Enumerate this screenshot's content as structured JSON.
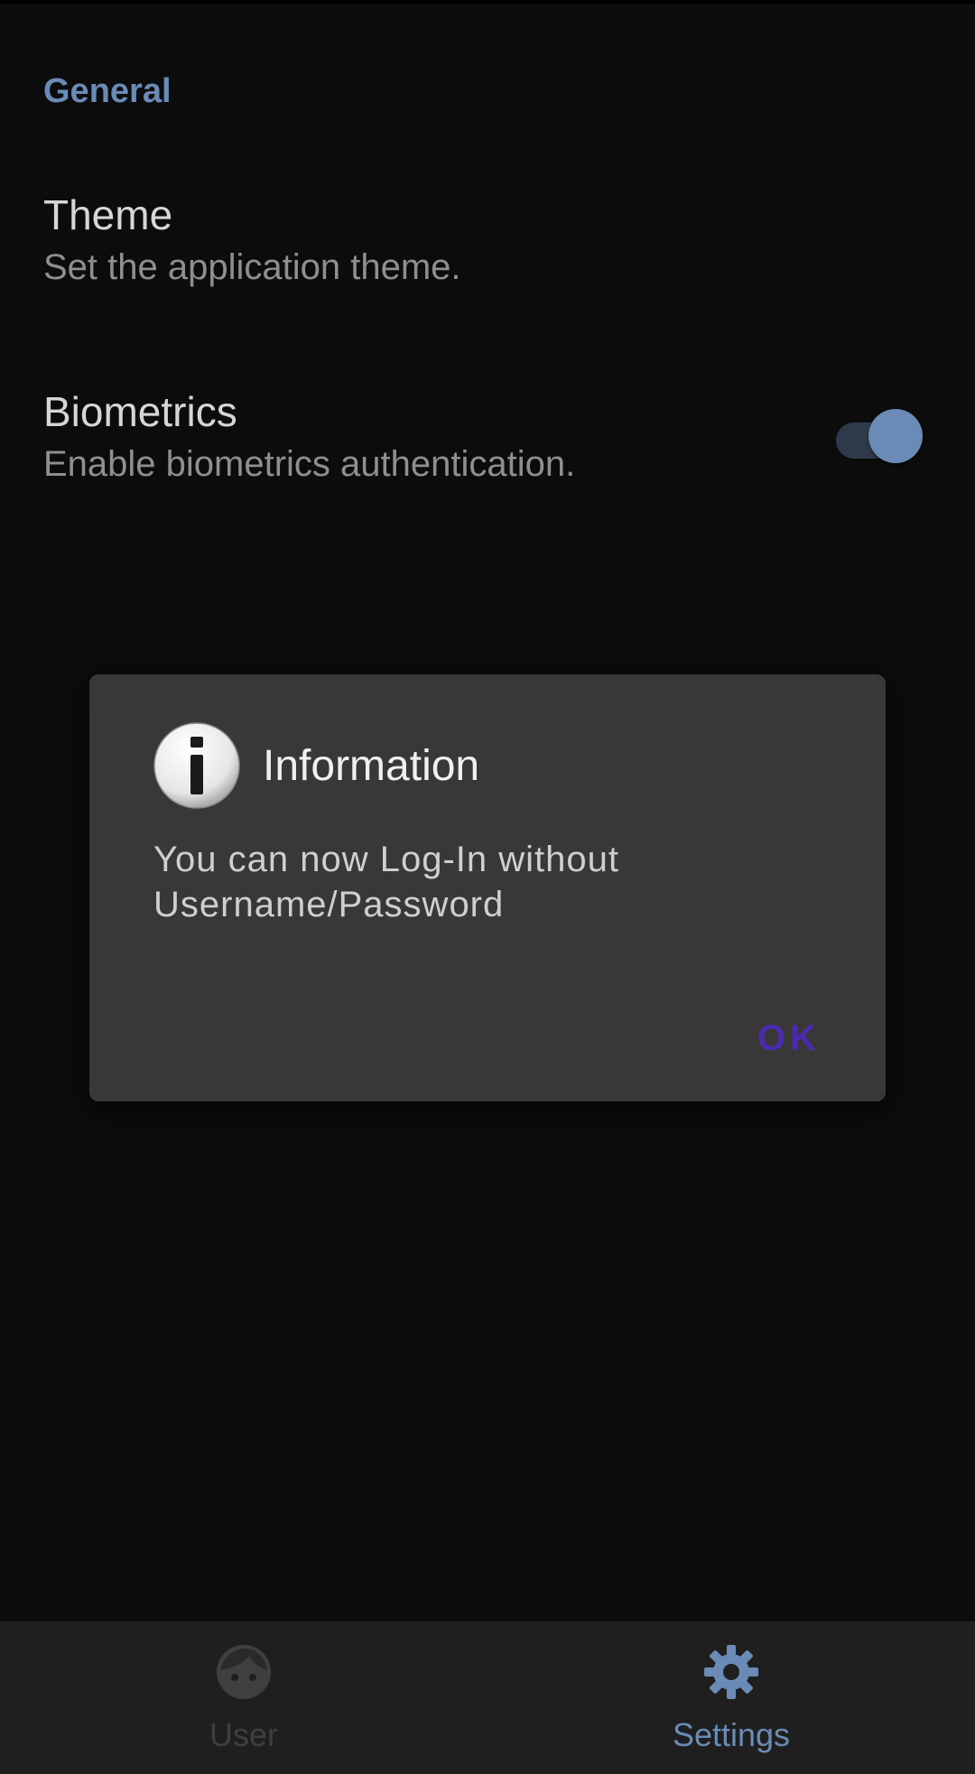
{
  "settings": {
    "section_header": "General",
    "theme": {
      "title": "Theme",
      "summary": "Set the application theme."
    },
    "biometrics": {
      "title": "Biometrics",
      "summary": "Enable biometrics authentication.",
      "enabled": true
    }
  },
  "dialog": {
    "icon": "info-icon",
    "title": "Information",
    "message": "You can now Log-In without Username/Password",
    "ok_label": "OK"
  },
  "bottom_nav": {
    "items": [
      {
        "label": "User",
        "icon": "face-icon",
        "active": false
      },
      {
        "label": "Settings",
        "icon": "gear-icon",
        "active": true
      }
    ]
  },
  "colors": {
    "accent": "#6a8bb6",
    "background": "#0c0c0c",
    "dialog_background": "#383838",
    "dialog_button": "#4a2bb0",
    "nav_background": "#1f1f1f"
  }
}
